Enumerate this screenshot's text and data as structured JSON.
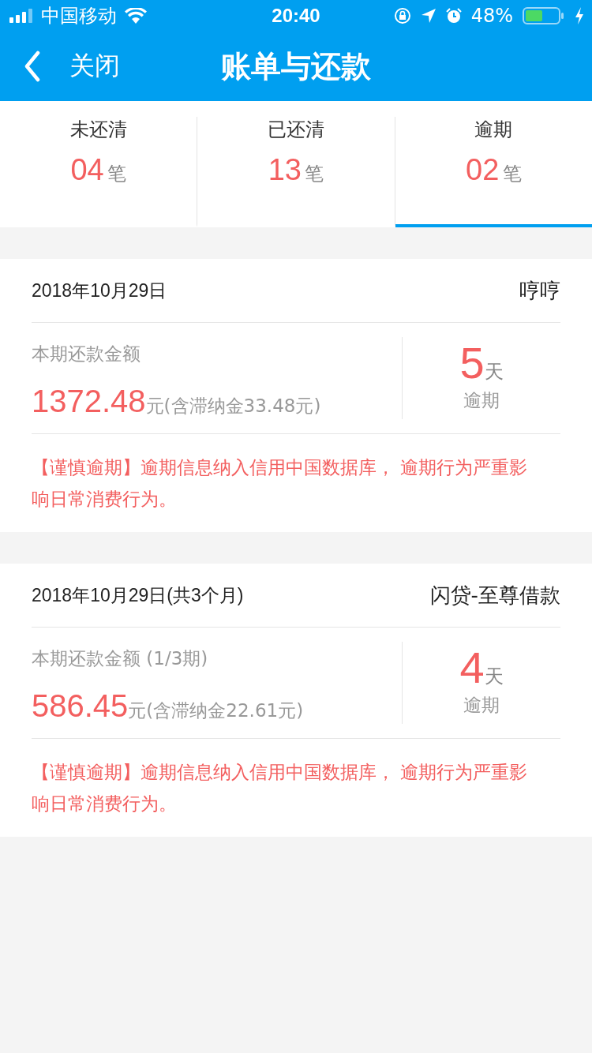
{
  "status_bar": {
    "carrier": "中国移动",
    "time": "20:40",
    "battery": "48%"
  },
  "nav": {
    "back": "关闭",
    "title": "账单与还款"
  },
  "tabs": [
    {
      "label": "未还清",
      "count": "04",
      "unit": "笔",
      "selected": false
    },
    {
      "label": "已还清",
      "count": "13",
      "unit": "笔",
      "selected": false
    },
    {
      "label": "逾期",
      "count": "02",
      "unit": "笔",
      "selected": true
    }
  ],
  "bills": [
    {
      "date": "2018年10月29日",
      "lender": "哼哼",
      "amount_label": "本期还款金额",
      "amount": "1372.48",
      "amount_note": "元(含滞纳金33.48元)",
      "days": "5",
      "days_unit": "天",
      "status": "逾期",
      "warning": "【谨慎逾期】逾期信息纳入信用中国数据库， 逾期行为严重影响日常消费行为。"
    },
    {
      "date": "2018年10月29日(共3个月)",
      "lender": "闪贷-至尊借款",
      "amount_label": "本期还款金额 (1/3期)",
      "amount": "586.45",
      "amount_note": "元(含滞纳金22.61元)",
      "days": "4",
      "days_unit": "天",
      "status": "逾期",
      "warning": "【谨慎逾期】逾期信息纳入信用中国数据库， 逾期行为严重影响日常消费行为。"
    }
  ]
}
